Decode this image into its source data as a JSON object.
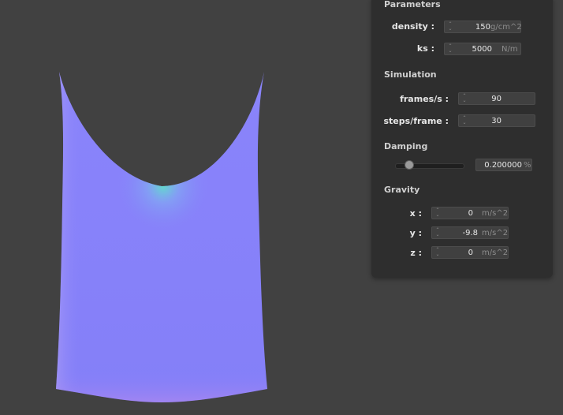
{
  "viewport": {
    "background_color": "#414141",
    "cloth_colors": {
      "main": "#8782fa",
      "edge_highlight": "#5ee3c8",
      "edge_soft": "#a89cf5"
    }
  },
  "panel": {
    "parameters": {
      "title": "Parameters",
      "density": {
        "label": "density :",
        "value": "150",
        "unit": "g/cm^2"
      },
      "ks": {
        "label": "ks :",
        "value": "5000",
        "unit": "N/m"
      }
    },
    "simulation": {
      "title": "Simulation",
      "frames_per_second": {
        "label": "frames/s :",
        "value": "90"
      },
      "steps_per_frame": {
        "label": "steps/frame :",
        "value": "30"
      }
    },
    "damping": {
      "title": "Damping",
      "slider_level": 0.2,
      "value": "0.200000",
      "unit": "%"
    },
    "gravity": {
      "title": "Gravity",
      "x": {
        "label": "x :",
        "value": "0",
        "unit": "m/s^2"
      },
      "y": {
        "label": "y :",
        "value": "-9.8",
        "unit": "m/s^2"
      },
      "z": {
        "label": "z :",
        "value": "0",
        "unit": "m/s^2"
      }
    }
  }
}
